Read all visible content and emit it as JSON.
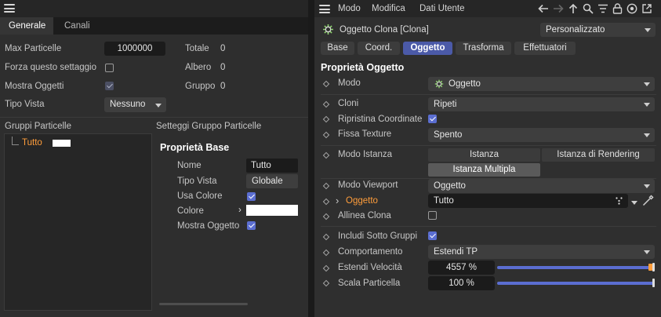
{
  "left": {
    "tabs": [
      "Generale",
      "Canali"
    ],
    "active_tab": 0,
    "rows": {
      "max_particelle": {
        "label": "Max Particelle",
        "value": "1000000"
      },
      "forza": {
        "label": "Forza questo settaggio",
        "checked": false
      },
      "mostra": {
        "label": "Mostra Oggetti",
        "checked": true
      },
      "tipo_vista": {
        "label": "Tipo Vista",
        "value": "Nessuno"
      }
    },
    "stats": [
      {
        "label": "Totale",
        "value": "0"
      },
      {
        "label": "Albero",
        "value": "0"
      },
      {
        "label": "Gruppo",
        "value": "0"
      }
    ],
    "groups": {
      "title": "Gruppi Particelle",
      "item": "Tutto",
      "item_color": "#ff9d3b"
    },
    "settings": {
      "title": "Setteggi Gruppo Particelle",
      "section": "Proprietà Base",
      "nome": {
        "label": "Nome",
        "value": "Tutto"
      },
      "tipo_vista": {
        "label": "Tipo Vista",
        "value": "Globale"
      },
      "usa_colore": {
        "label": "Usa Colore",
        "checked": true
      },
      "colore": {
        "label": "Colore",
        "value": "#ffffff"
      },
      "mostra_oggetto": {
        "label": "Mostra Oggetto",
        "checked": true
      }
    }
  },
  "right": {
    "menu": [
      "Modo",
      "Modifica",
      "Dati Utente"
    ],
    "object_title": "Oggetto Clona [Clona]",
    "preset": "Personalizzato",
    "tabs": [
      "Base",
      "Coord.",
      "Oggetto",
      "Trasforma",
      "Effettuatori"
    ],
    "active_tab": 2,
    "section_title": "Proprietà Oggetto",
    "accent": "#5b6ed1",
    "rows": {
      "modo": {
        "label": "Modo",
        "value": "Oggetto"
      },
      "cloni": {
        "label": "Cloni",
        "value": "Ripeti"
      },
      "ripristina": {
        "label": "Ripristina Coordinate",
        "checked": true
      },
      "fissa_texture": {
        "label": "Fissa Texture",
        "value": "Spento"
      },
      "modo_istanza": {
        "label": "Modo Istanza",
        "options": [
          "Istanza",
          "Istanza di Rendering",
          "Istanza Multipla"
        ],
        "selected": 2
      },
      "modo_viewport": {
        "label": "Modo Viewport",
        "value": "Oggetto"
      },
      "oggetto": {
        "label": "Oggetto",
        "value": "Tutto",
        "label_color": "#ff9d3b"
      },
      "allinea": {
        "label": "Allinea Clona",
        "checked": false
      },
      "includi": {
        "label": "Includi Sotto Gruppi",
        "checked": true
      },
      "comportamento": {
        "label": "Comportamento",
        "value": "Estendi TP"
      },
      "estendi_velocita": {
        "label": "Estendi Velocità",
        "value": "4557 %",
        "slider_fraction": 1.0
      },
      "scala_particella": {
        "label": "Scala Particella",
        "value": "100 %",
        "slider_fraction": 1.0
      }
    }
  }
}
